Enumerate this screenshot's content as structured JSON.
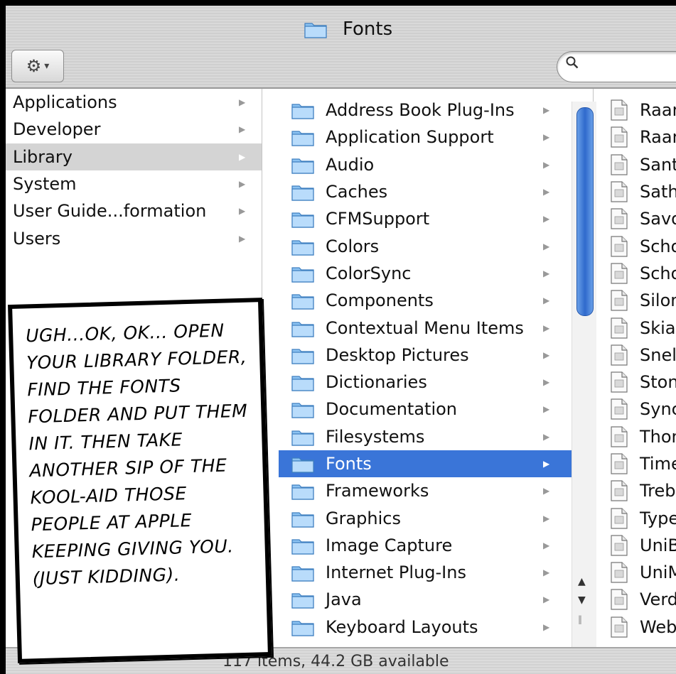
{
  "window": {
    "title": "Fonts"
  },
  "toolbar": {
    "action_icon": "gear-icon",
    "chevron": "▾",
    "search_icon": "search-icon",
    "search_value": ""
  },
  "column1": {
    "items": [
      {
        "label": "Applications"
      },
      {
        "label": "Developer"
      },
      {
        "label": "Library",
        "selected": true
      },
      {
        "label": "System"
      },
      {
        "label": "User Guide...formation"
      },
      {
        "label": "Users"
      }
    ]
  },
  "column2": {
    "items": [
      {
        "label": "Address Book Plug-Ins"
      },
      {
        "label": "Application Support"
      },
      {
        "label": "Audio"
      },
      {
        "label": "Caches"
      },
      {
        "label": "CFMSupport"
      },
      {
        "label": "Colors"
      },
      {
        "label": "ColorSync"
      },
      {
        "label": "Components"
      },
      {
        "label": "Contextual Menu Items"
      },
      {
        "label": "Desktop Pictures"
      },
      {
        "label": "Dictionaries"
      },
      {
        "label": "Documentation"
      },
      {
        "label": "Filesystems"
      },
      {
        "label": "Fonts",
        "selected": true
      },
      {
        "label": "Frameworks"
      },
      {
        "label": "Graphics"
      },
      {
        "label": "Image Capture"
      },
      {
        "label": "Internet Plug-Ins"
      },
      {
        "label": "Java"
      },
      {
        "label": "Keyboard Layouts"
      }
    ]
  },
  "column3": {
    "items": [
      {
        "label": "Raan"
      },
      {
        "label": "Raan"
      },
      {
        "label": "Santa"
      },
      {
        "label": "Sathu"
      },
      {
        "label": "Savoy"
      },
      {
        "label": "Schoo"
      },
      {
        "label": "Schoo"
      },
      {
        "label": "Silom"
      },
      {
        "label": "Skia.d"
      },
      {
        "label": "Snell"
      },
      {
        "label": "Stone"
      },
      {
        "label": "Synch"
      },
      {
        "label": "Thom"
      },
      {
        "label": "Time"
      },
      {
        "label": "Trebu"
      },
      {
        "label": "Type"
      },
      {
        "label": "UniBu"
      },
      {
        "label": "UniM"
      },
      {
        "label": "Verda"
      },
      {
        "label": "Webo"
      }
    ]
  },
  "status": {
    "text": "117 items, 44.2 GB available"
  },
  "caption": {
    "text": "Ugh...ok, ok... open your Library folder, find the Fonts folder and put them in it. Then take another sip of the kool-aid those people at Apple keeping giving you. (Just kidding)."
  },
  "colors": {
    "selection": "#3a75d8",
    "sidebar_selection": "#d4d4d4"
  }
}
